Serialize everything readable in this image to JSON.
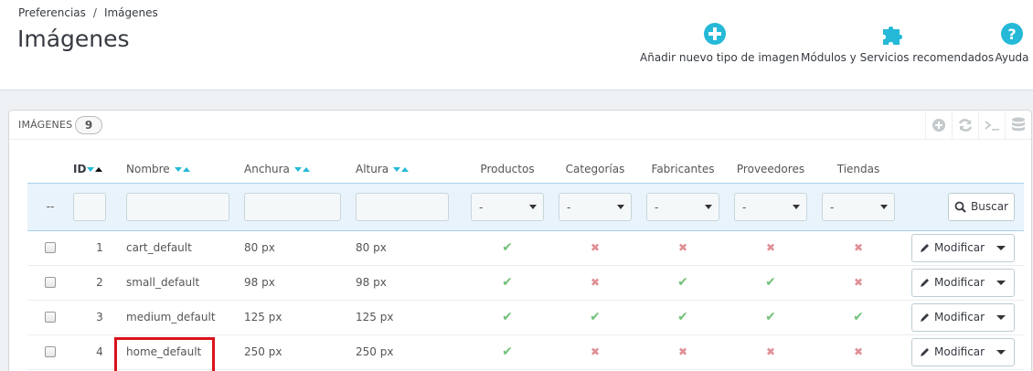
{
  "breadcrumb": {
    "parent": "Preferencias",
    "separator": "/",
    "current": "Imágenes"
  },
  "page_title": "Imágenes",
  "toolbar": {
    "add_label": "Añadir nuevo tipo de imagen",
    "modules_label": "Módulos y Servicios recomendados",
    "help_label": "Ayuda",
    "icons": [
      "plus-circle-icon",
      "puzzle-icon",
      "question-circle-icon"
    ]
  },
  "panel": {
    "title": "IMÁGENES",
    "count": "9",
    "tools": [
      "add-icon",
      "refresh-icon",
      "terminal-icon",
      "database-icon"
    ]
  },
  "table": {
    "headers": {
      "id": "ID",
      "name": "Nombre",
      "width": "Anchura",
      "height": "Altura",
      "products": "Productos",
      "categories": "Categorías",
      "manufacturers": "Fabricantes",
      "suppliers": "Proveedores",
      "stores": "Tiendas"
    },
    "filter": {
      "bulk": "--",
      "select_value": "-",
      "search_label": "Buscar"
    },
    "rows": [
      {
        "id": "1",
        "name": "cart_default",
        "width": "80 px",
        "height": "80 px",
        "products": true,
        "categories": false,
        "manufacturers": false,
        "suppliers": false,
        "stores": false
      },
      {
        "id": "2",
        "name": "small_default",
        "width": "98 px",
        "height": "98 px",
        "products": true,
        "categories": false,
        "manufacturers": true,
        "suppliers": true,
        "stores": false
      },
      {
        "id": "3",
        "name": "medium_default",
        "width": "125 px",
        "height": "125 px",
        "products": true,
        "categories": true,
        "manufacturers": true,
        "suppliers": true,
        "stores": true
      },
      {
        "id": "4",
        "name": "home_default",
        "width": "250 px",
        "height": "250 px",
        "products": true,
        "categories": false,
        "manufacturers": false,
        "suppliers": false,
        "stores": false
      }
    ],
    "edit_label": "Modificar"
  },
  "colors": {
    "accent": "#25b9d7",
    "ok": "#72c279",
    "no": "#e08f95",
    "highlight": "#d9141b"
  }
}
